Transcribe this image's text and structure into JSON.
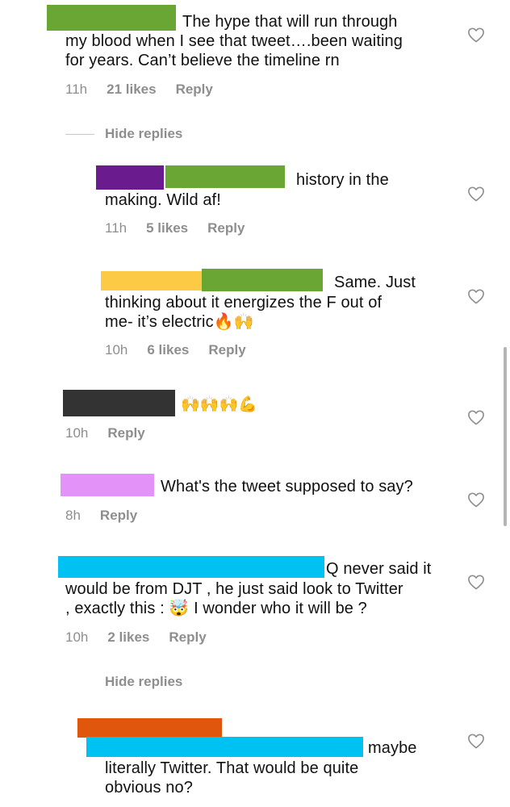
{
  "colors": {
    "green": "#6aa633",
    "purple": "#6a1b8e",
    "yellow": "#fcca44",
    "dark": "#333333",
    "pink": "#e393f7",
    "cyan": "#00c2f2",
    "orange": "#e0560c",
    "meta_gray": "#8e8e8e"
  },
  "comments": [
    {
      "text_lines": [
        "The hype that will run through",
        "my blood when I see that tweet….been waiting",
        "for years. Can’t believe the timeline rn"
      ],
      "time": "11h",
      "likes": "21 likes",
      "reply": "Reply"
    },
    {
      "text_lines": [
        "history in the",
        "making. Wild af!"
      ],
      "time": "11h",
      "likes": "5 likes",
      "reply": "Reply"
    },
    {
      "text_lines": [
        "Same. Just",
        "thinking about it energizes the F out of",
        "me- it’s electric🔥🙌"
      ],
      "time": "10h",
      "likes": "6 likes",
      "reply": "Reply"
    },
    {
      "text_lines": [
        "🙌🙌🙌💪"
      ],
      "time": "10h",
      "reply": "Reply"
    },
    {
      "text_lines": [
        "What's the tweet supposed to say?"
      ],
      "time": "8h",
      "reply": "Reply"
    },
    {
      "text_lines": [
        "Q never said it",
        "would be from DJT , he just said look to Twitter",
        ", exactly this : 🤯 I wonder who it will be ?"
      ],
      "time": "10h",
      "likes": "2 likes",
      "reply": "Reply"
    },
    {
      "text_lines": [
        "maybe",
        "literally Twitter. That would be quite",
        "obvious no?"
      ]
    }
  ],
  "hide_replies": [
    "Hide replies",
    "Hide replies"
  ],
  "icons": {
    "like": "heart-outline-icon"
  }
}
